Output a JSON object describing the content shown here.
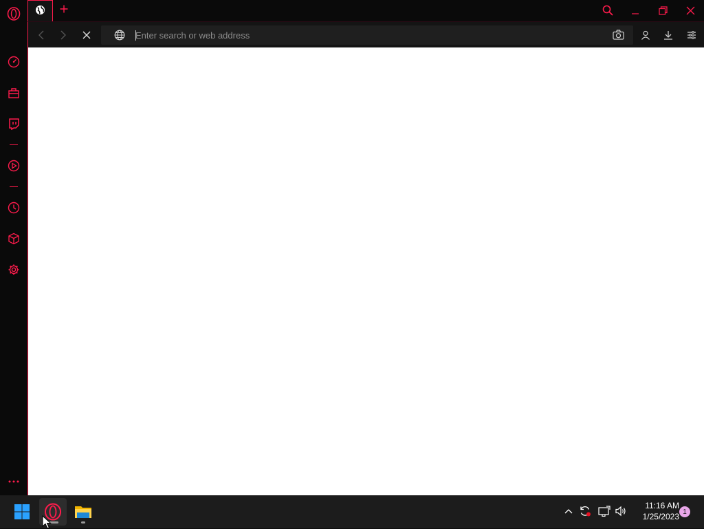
{
  "colors": {
    "accent": "#ff1b4c",
    "sidebar_bg": "#0a0a0a",
    "toolbar_bg": "#141414",
    "address_bg": "#1f1f1f",
    "content_bg": "#ffffff",
    "taskbar_bg": "#1c1c1c",
    "windows_blue": "#2aa1ff",
    "notification_badge": "#e8a6e8"
  },
  "sidebar": {
    "items": [
      {
        "icon": "opera-logo-icon"
      },
      {
        "icon": "speed-dial-icon"
      },
      {
        "icon": "extensions-icon"
      },
      {
        "icon": "twitch-icon"
      },
      {
        "icon": "player-icon"
      },
      {
        "icon": "history-icon"
      },
      {
        "icon": "box-icon"
      },
      {
        "icon": "settings-icon"
      },
      {
        "icon": "more-icon"
      }
    ]
  },
  "tabs": [
    {
      "icon": "globe-icon",
      "active": true
    }
  ],
  "window_controls": [
    "search-icon",
    "minimize-icon",
    "restore-icon",
    "close-icon"
  ],
  "address_bar": {
    "placeholder": "Enter search or web address",
    "value": ""
  },
  "toolbar_icons": [
    "back-icon",
    "forward-icon",
    "stop-icon",
    "globe-icon",
    "camera-icon",
    "account-icon",
    "download-icon",
    "easy-setup-icon"
  ],
  "taskbar": {
    "apps": [
      {
        "name": "start-button",
        "icon": "windows-logo-icon"
      },
      {
        "name": "opera-gx",
        "icon": "opera-logo-icon",
        "active": true
      },
      {
        "name": "file-explorer",
        "icon": "folder-icon"
      }
    ],
    "tray_icons": [
      "chevron-up-icon",
      "sync-icon",
      "network-icon",
      "volume-icon"
    ],
    "time": "11:16 AM",
    "date": "1/25/2023",
    "notification_count": "1"
  }
}
